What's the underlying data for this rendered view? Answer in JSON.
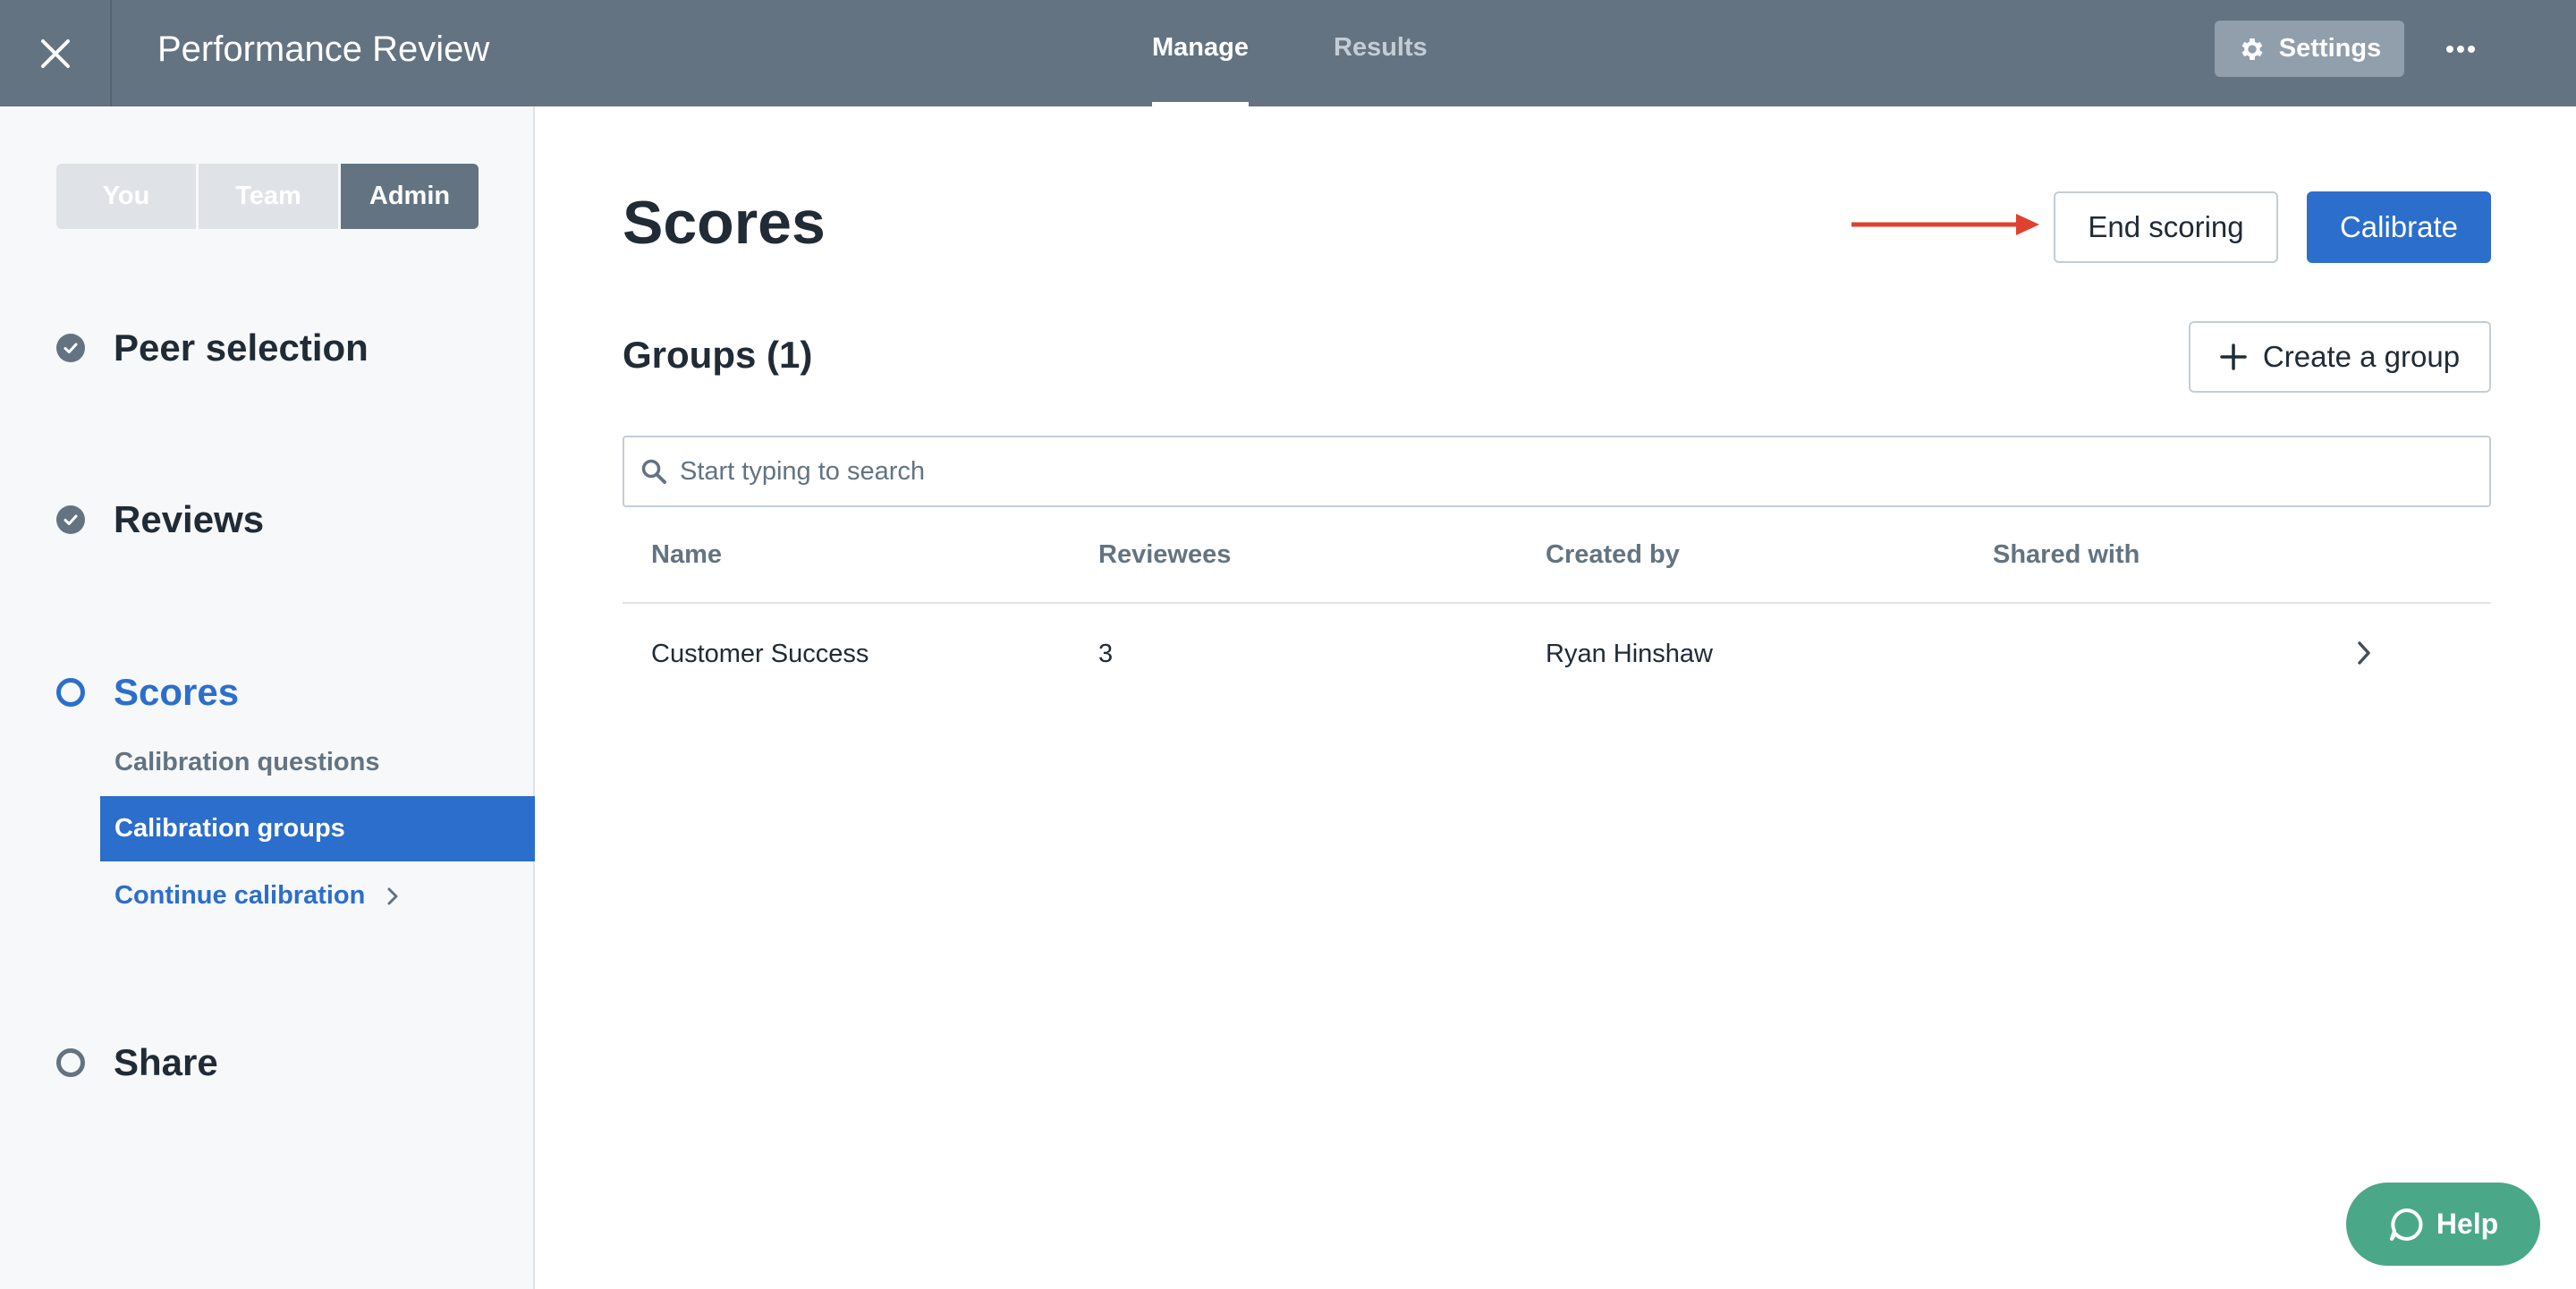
{
  "header": {
    "title": "Performance Review",
    "tabs": [
      {
        "label": "Manage",
        "active": true
      },
      {
        "label": "Results",
        "active": false
      }
    ],
    "settings_label": "Settings",
    "icons": {
      "close": "close-icon",
      "settings": "gear-icon",
      "more": "more-horizontal-icon"
    }
  },
  "sidebar": {
    "segments": [
      {
        "label": "You",
        "selected": false
      },
      {
        "label": "Team",
        "selected": false
      },
      {
        "label": "Admin",
        "selected": true
      }
    ],
    "steps": [
      {
        "label": "Peer selection",
        "status": "complete"
      },
      {
        "label": "Reviews",
        "status": "complete"
      },
      {
        "label": "Scores",
        "status": "current"
      },
      {
        "label": "Share",
        "status": "pending"
      }
    ],
    "sub_items": [
      {
        "label": "Calibration questions",
        "selected": false
      },
      {
        "label": "Calibration groups",
        "selected": true
      },
      {
        "label": "Continue calibration",
        "selected": false
      }
    ]
  },
  "main": {
    "title": "Scores",
    "end_scoring_label": "End scoring",
    "calibrate_label": "Calibrate",
    "groups_title": "Groups (1)",
    "create_group_label": "Create a group",
    "search": {
      "placeholder": "Start typing to search",
      "value": ""
    },
    "table": {
      "columns": [
        "Name",
        "Reviewees",
        "Created by",
        "Shared with"
      ],
      "rows": [
        {
          "name": "Customer Success",
          "reviewees": "3",
          "created_by": "Ryan Hinshaw",
          "shared_with": ""
        }
      ]
    }
  },
  "help_label": "Help",
  "colors": {
    "header_bg": "#637381",
    "primary": "#2c6ecb",
    "help_bg": "#4aa889",
    "annotation_arrow": "#e0412f",
    "sidebar_bg": "#f7f8fa"
  }
}
